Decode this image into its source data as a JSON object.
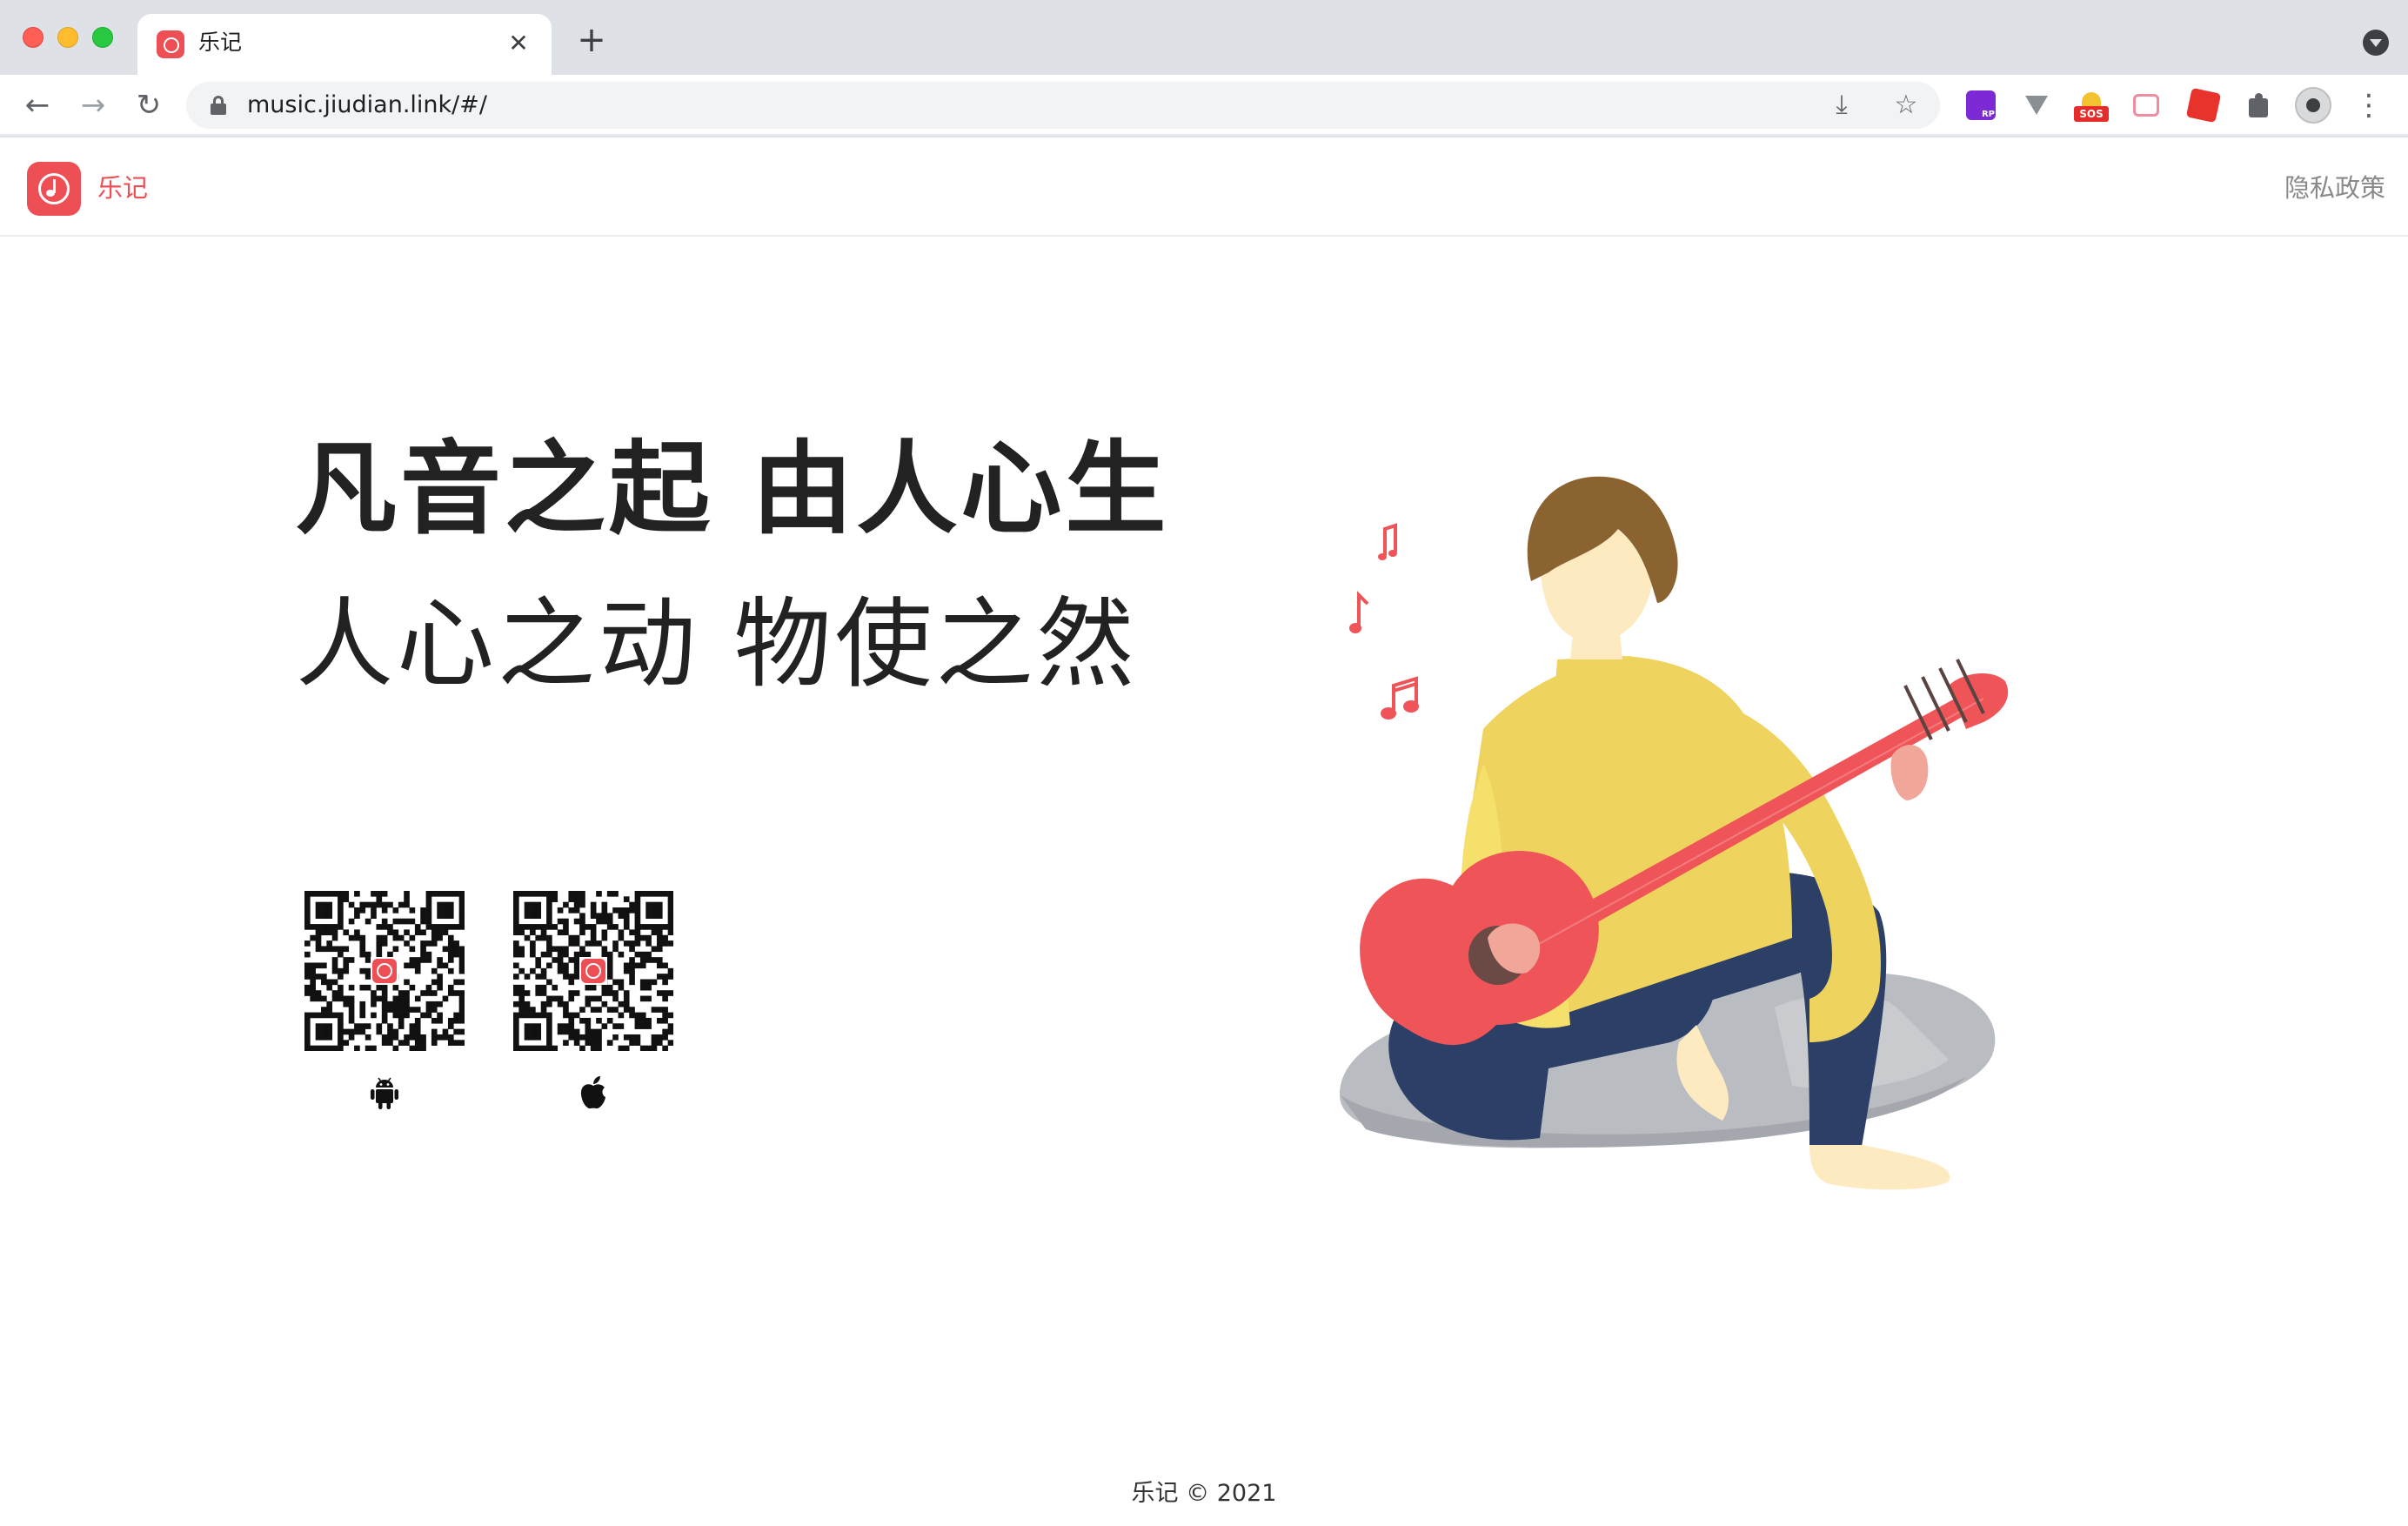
{
  "browser": {
    "tab_title": "乐记",
    "url": "music.jiudian.link/#/",
    "tab_close_glyph": "✕",
    "new_tab_glyph": "+",
    "back_glyph": "←",
    "forward_glyph": "→",
    "reload_glyph": "↻",
    "install_glyph": "⤓",
    "star_glyph": "☆",
    "menu_glyph": "⋮",
    "extension_sos_label": "SOS"
  },
  "header": {
    "brand": "乐记",
    "privacy": "隐私政策"
  },
  "hero": {
    "headline": "凡音之起 由人心生",
    "subline": "人心之动 物使之然"
  },
  "downloads": [
    {
      "platform": "android",
      "icon": "android-icon"
    },
    {
      "platform": "ios",
      "icon": "apple-icon"
    }
  ],
  "footer": {
    "text": "乐记 © 2021"
  },
  "colors": {
    "brand": "#ee4f55",
    "sweater": "#eed45e",
    "pants": "#2c3f67",
    "guitar": "#ee5458",
    "hair": "#8b6331",
    "skin": "#fdeac0",
    "rock": "#b5b8bd"
  }
}
